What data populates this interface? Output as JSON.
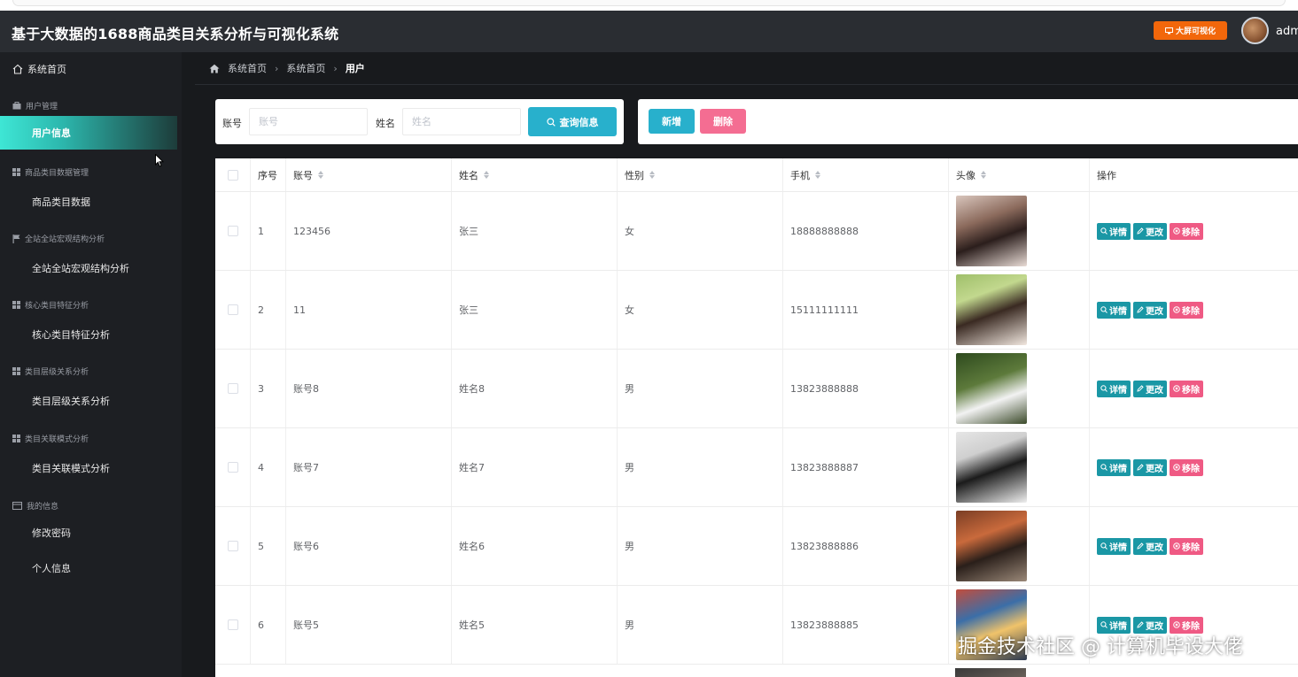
{
  "header": {
    "title": "基于大数据的1688商品类目关系分析与可视化系统",
    "bigscreen_label": "大屏可视化",
    "user_name": "admi"
  },
  "sidebar": {
    "home_label": "系统首页",
    "groups": [
      {
        "label": "用户管理",
        "icon": "id-card-icon",
        "items": [
          {
            "label": "用户信息",
            "active": true
          }
        ]
      },
      {
        "label": "商品类目数据管理",
        "icon": "grid-icon",
        "items": [
          {
            "label": "商品类目数据"
          }
        ]
      },
      {
        "label": "全站全站宏观结构分析",
        "icon": "flag-icon",
        "items": [
          {
            "label": "全站全站宏观结构分析"
          }
        ]
      },
      {
        "label": "核心类目特征分析",
        "icon": "grid-icon",
        "items": [
          {
            "label": "核心类目特征分析"
          }
        ]
      },
      {
        "label": "类目层级关系分析",
        "icon": "grid-icon",
        "items": [
          {
            "label": "类目层级关系分析"
          }
        ]
      },
      {
        "label": "类目关联模式分析",
        "icon": "grid-icon",
        "items": [
          {
            "label": "类目关联模式分析"
          }
        ]
      },
      {
        "label": "我的信息",
        "icon": "card-icon",
        "items": [
          {
            "label": "修改密码"
          },
          {
            "label": "个人信息"
          }
        ]
      }
    ]
  },
  "breadcrumb": [
    "系统首页",
    "系统首页",
    "用户"
  ],
  "search": {
    "account_label": "账号",
    "account_placeholder": "账号",
    "name_label": "姓名",
    "name_placeholder": "姓名",
    "query_label": "查询信息"
  },
  "actions": {
    "add_label": "新增",
    "delete_label": "删除"
  },
  "table": {
    "columns": [
      "序号",
      "账号",
      "姓名",
      "性别",
      "手机",
      "头像",
      "操作"
    ],
    "rows": [
      {
        "index": "1",
        "account": "123456",
        "name": "张三",
        "gender": "女",
        "phone": "18888888888"
      },
      {
        "index": "2",
        "account": "11",
        "name": "张三",
        "gender": "女",
        "phone": "15111111111"
      },
      {
        "index": "3",
        "account": "账号8",
        "name": "姓名8",
        "gender": "男",
        "phone": "13823888888"
      },
      {
        "index": "4",
        "account": "账号7",
        "name": "姓名7",
        "gender": "男",
        "phone": "13823888887"
      },
      {
        "index": "5",
        "account": "账号6",
        "name": "姓名6",
        "gender": "男",
        "phone": "13823888886"
      },
      {
        "index": "6",
        "account": "账号5",
        "name": "姓名5",
        "gender": "男",
        "phone": "13823888885"
      }
    ],
    "op_labels": {
      "detail": "详情",
      "edit": "更改",
      "remove": "移除"
    }
  },
  "watermark": "掘金技术社区 @ 计算机毕设大佬",
  "colors": {
    "accent": "#28b0cc",
    "danger": "#f46d92",
    "orange": "#f2670b",
    "active_nav": "#3ee6d5"
  }
}
